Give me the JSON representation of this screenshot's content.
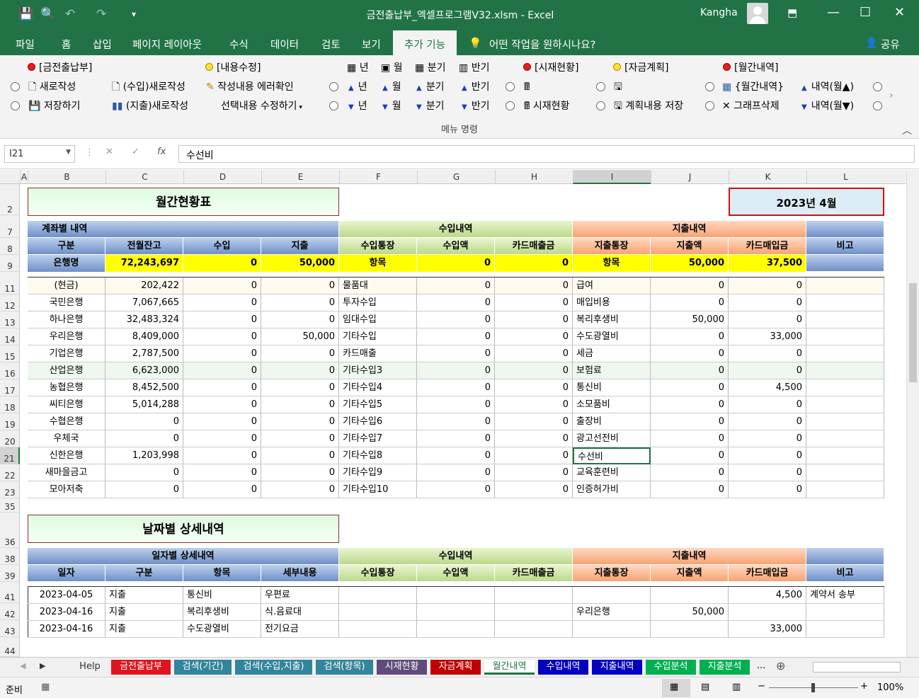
{
  "window": {
    "title": "금전출납부_엑셀프로그램V32.xlsm  -  Excel",
    "user": "Kangha"
  },
  "menu": [
    "파일",
    "홈",
    "삽입",
    "페이지 레이아웃",
    "수식",
    "데이터",
    "검토",
    "보기",
    "추가 기능"
  ],
  "tell_me": "어떤 작업을 원하시나요?",
  "share": "공유",
  "ribbon": {
    "g1": {
      "title": "[금전출납부]",
      "new": "새로작성",
      "save": "저장하기"
    },
    "g2": {
      "income_new": "(수입)새로작성",
      "expense_new": "(지출)새로작성"
    },
    "g3": {
      "title": "[내용수정]",
      "check": "작성내용 에러확인",
      "edit": "선택내용 수정하기"
    },
    "period": {
      "year": "년",
      "month": "월",
      "quarter": "분기",
      "half": "반기"
    },
    "g4": {
      "title": "[시재현황]",
      "btn": "시재현황"
    },
    "g5": {
      "title": "[자금계획]",
      "btn": "계획내용 저장"
    },
    "g6": {
      "title": "[월간내역]",
      "monthly": "{월간내역}",
      "graph_del": "그래프삭제",
      "up": "내역(월▲)",
      "down": "내역(월▼)"
    },
    "group_label": "메뉴 명령"
  },
  "namebox": "I21",
  "formula": "수선비",
  "columns": [
    "A",
    "B",
    "C",
    "D",
    "E",
    "F",
    "G",
    "H",
    "I",
    "J",
    "K",
    "L"
  ],
  "rows": [
    "2",
    "7",
    "8",
    "9",
    "11",
    "12",
    "13",
    "14",
    "15",
    "16",
    "17",
    "18",
    "19",
    "20",
    "21",
    "22",
    "23",
    "35",
    "36",
    "38",
    "39",
    "41",
    "42",
    "43",
    "44"
  ],
  "sheet": {
    "title1": "월간현황표",
    "date": "2023년 4월",
    "hdr7": {
      "a": "계좌별 내역",
      "b": "수입내역",
      "c": "지출내역"
    },
    "hdr8": [
      "구분",
      "전월잔고",
      "수입",
      "지출",
      "수입통장",
      "수입액",
      "카드매출금",
      "지출통장",
      "지출액",
      "카드매입금",
      "비고"
    ],
    "row9": [
      "은행명",
      "72,243,697",
      "0",
      "50,000",
      "항목",
      "0",
      "0",
      "항목",
      "50,000",
      "37,500",
      ""
    ],
    "banks": [
      [
        "(현금)",
        "202,422",
        "0",
        "0",
        "물품대",
        "0",
        "0",
        "급여",
        "0",
        "0"
      ],
      [
        "국민은행",
        "7,067,665",
        "0",
        "0",
        "투자수입",
        "0",
        "0",
        "매입비용",
        "0",
        "0"
      ],
      [
        "하나은행",
        "32,483,324",
        "0",
        "0",
        "임대수입",
        "0",
        "0",
        "복리후생비",
        "50,000",
        "0"
      ],
      [
        "우리은행",
        "8,409,000",
        "0",
        "50,000",
        "기타수입",
        "0",
        "0",
        "수도광열비",
        "0",
        "33,000"
      ],
      [
        "기업은행",
        "2,787,500",
        "0",
        "0",
        "카드매출",
        "0",
        "0",
        "세금",
        "0",
        "0"
      ],
      [
        "산업은행",
        "6,623,000",
        "0",
        "0",
        "기타수입3",
        "0",
        "0",
        "보험료",
        "0",
        "0"
      ],
      [
        "농협은행",
        "8,452,500",
        "0",
        "0",
        "기타수입4",
        "0",
        "0",
        "통신비",
        "0",
        "4,500"
      ],
      [
        "씨티은행",
        "5,014,288",
        "0",
        "0",
        "기타수입5",
        "0",
        "0",
        "소모품비",
        "0",
        "0"
      ],
      [
        "수협은행",
        "0",
        "0",
        "0",
        "기타수입6",
        "0",
        "0",
        "출장비",
        "0",
        "0"
      ],
      [
        "우체국",
        "0",
        "0",
        "0",
        "기타수입7",
        "0",
        "0",
        "광고선전비",
        "0",
        "0"
      ],
      [
        "신한은행",
        "1,203,998",
        "0",
        "0",
        "기타수입8",
        "0",
        "0",
        "수선비",
        "0",
        "0"
      ],
      [
        "새마을금고",
        "0",
        "0",
        "0",
        "기타수입9",
        "0",
        "0",
        "교육훈련비",
        "0",
        "0"
      ],
      [
        "모아저축",
        "0",
        "0",
        "0",
        "기타수입10",
        "0",
        "0",
        "인증허가비",
        "0",
        "0"
      ]
    ],
    "title2": "날짜별 상세내역",
    "hdr38": {
      "a": "일자별 상세내역",
      "b": "수입내역",
      "c": "지출내역"
    },
    "hdr39": [
      "일자",
      "구분",
      "항목",
      "세부내용",
      "수입통장",
      "수입액",
      "카드매출금",
      "지출통장",
      "지출액",
      "카드매입금",
      "비고"
    ],
    "details": [
      [
        "2023-04-05",
        "지출",
        "통신비",
        "우편료",
        "",
        "",
        "",
        "",
        "",
        "4,500",
        "계약서 송부"
      ],
      [
        "2023-04-16",
        "지출",
        "복리후생비",
        "식.음료대",
        "",
        "",
        "",
        "우리은행",
        "50,000",
        "",
        ""
      ],
      [
        "2023-04-16",
        "지출",
        "수도광열비",
        "전기요금",
        "",
        "",
        "",
        "",
        "",
        "33,000",
        ""
      ]
    ]
  },
  "tabs": [
    "Help",
    "금전출납부",
    "검색(기간)",
    "검색(수입,지출)",
    "검색(항목)",
    "시재현황",
    "자금계획",
    "월간내역",
    "수입내역",
    "지출내역",
    "수입분석",
    "지출분석"
  ],
  "tab_colors": [
    "#f0f0f0",
    "#e0141e",
    "#31859c",
    "#31859c",
    "#31859c",
    "#604a7b",
    "#c00000",
    "#ffffff",
    "#0000c0",
    "#0000c0",
    "#00b050",
    "#00b050"
  ],
  "status": {
    "ready": "준비",
    "zoom": "100%"
  }
}
